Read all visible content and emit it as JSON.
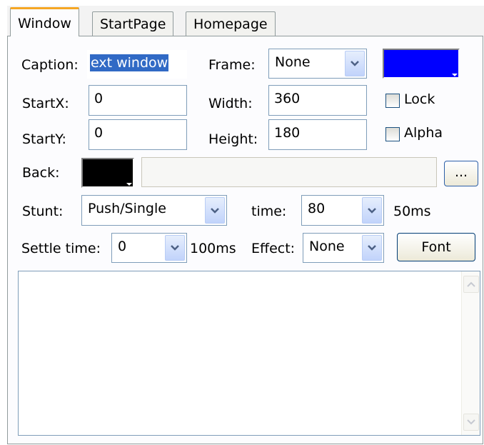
{
  "tabs": [
    {
      "label": "Window",
      "active": true
    },
    {
      "label": "StartPage",
      "active": false
    },
    {
      "label": "Homepage",
      "active": false
    }
  ],
  "form": {
    "caption_label": "Caption:",
    "caption_value": "ext window",
    "frame_label": "Frame:",
    "frame_value": "None",
    "startx_label": "StartX:",
    "startx_value": "0",
    "width_label": "Width:",
    "width_value": "360",
    "lock_label": "Lock",
    "starty_label": "StartY:",
    "starty_value": "0",
    "height_label": "Height:",
    "height_value": "180",
    "alpha_label": "Alpha",
    "back_label": "Back:",
    "back_path_value": "",
    "browse_label": "...",
    "stunt_label": "Stunt:",
    "stunt_value": "Push/Single",
    "time_label": "time:",
    "time_value": "80",
    "time_unit": "50ms",
    "settle_label": "Settle time:",
    "settle_value": "0",
    "settle_unit": "100ms",
    "effect_label": "Effect:",
    "effect_value": "None",
    "font_button": "Font"
  },
  "colors": {
    "frame_color": "#0000ff",
    "back_color": "#000000",
    "caption_highlight": "#316ac5",
    "tab_accent": "#f5a623"
  },
  "icons": {
    "dropdown": "chevron-down-icon",
    "scroll_up": "scroll-up-icon",
    "scroll_down": "scroll-down-icon"
  },
  "memo": {
    "text": ""
  }
}
